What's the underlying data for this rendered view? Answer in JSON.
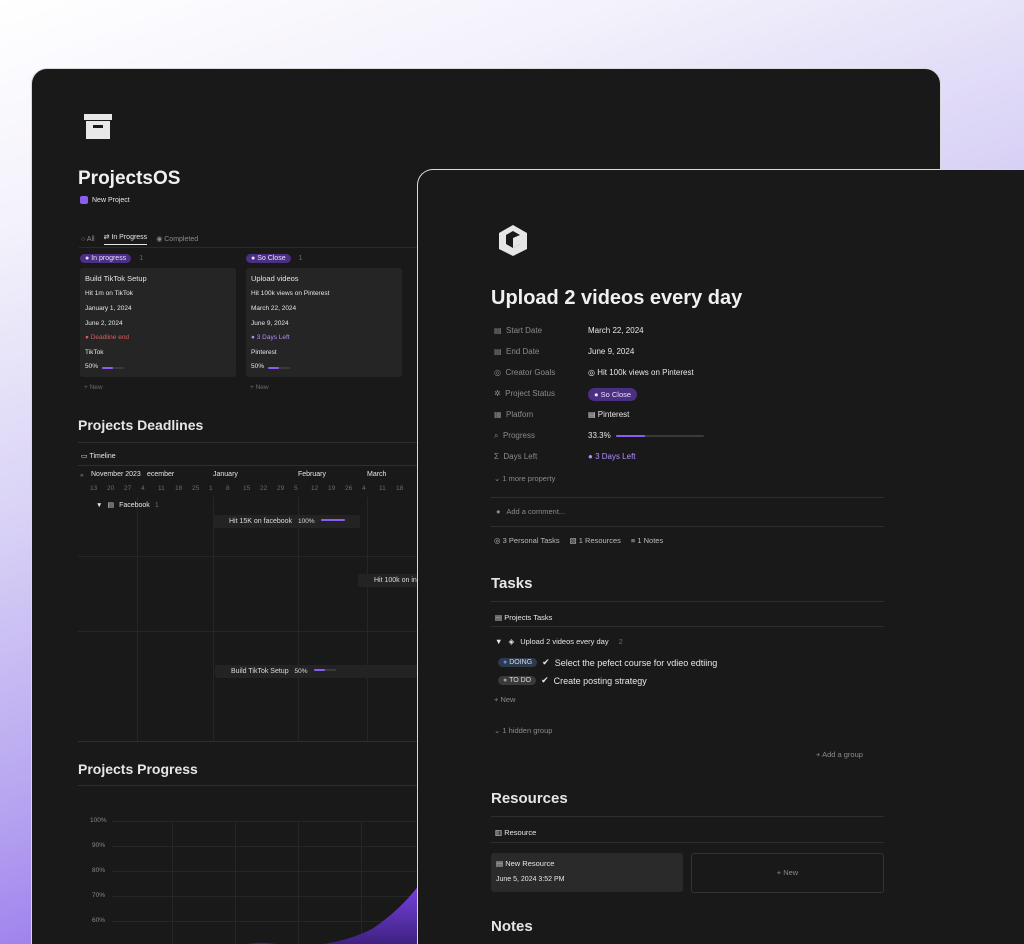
{
  "back": {
    "title": "ProjectsOS",
    "new_project": "New Project",
    "tabs": [
      "All",
      "In Progress",
      "Completed"
    ],
    "board": {
      "groups": [
        {
          "label": "In progress",
          "count": "1",
          "card": {
            "title": "Build TikTok Setup",
            "goal": "Hit 1m on TikTok",
            "start": "January 1, 2024",
            "end": "June 2, 2024",
            "status": "Deadline end",
            "platform": "TikTok",
            "progress_label": "50%",
            "progress": 0.5
          },
          "new": "New"
        },
        {
          "label": "So Close",
          "count": "1",
          "card": {
            "title": "Upload videos",
            "goal": "Hit 100k views on Pinterest",
            "start": "March 22, 2024",
            "end": "June 9, 2024",
            "status": "3  Days Left",
            "platform": "Pinterest",
            "progress_label": "50%",
            "progress": 0.5
          },
          "new": "New"
        }
      ]
    },
    "deadlines": {
      "heading": "Projects Deadlines",
      "view": "Timeline",
      "months": [
        "November 2023",
        "ecember",
        "January",
        "February",
        "March"
      ],
      "days": [
        "13",
        "20",
        "27",
        "4",
        "11",
        "18",
        "25",
        "1",
        "8",
        "15",
        "22",
        "29",
        "5",
        "12",
        "19",
        "26",
        "4",
        "11",
        "18"
      ],
      "group_label": "Facebook",
      "group_count": "1",
      "bars": [
        {
          "label": "Hit 15K on facebook",
          "pct": "100%",
          "progress": 1.0
        },
        {
          "label": "Hit 100k on in",
          "pct": "",
          "progress": 0
        },
        {
          "label": "Build TikTok Setup",
          "pct": "50%",
          "progress": 0.5
        }
      ]
    },
    "progress": {
      "heading": "Projects Progress",
      "y_ticks": [
        "100%",
        "90%",
        "80%",
        "70%",
        "60%"
      ]
    }
  },
  "front": {
    "title": "Upload 2 videos every day",
    "properties": [
      {
        "label": "Start Date",
        "value": "March 22, 2024",
        "icon": "calendar-icon"
      },
      {
        "label": "End Date",
        "value": "June 9, 2024",
        "icon": "calendar-icon"
      },
      {
        "label": "Creator Goals",
        "value": "Hit 100k views on Pinterest",
        "icon": "target-icon"
      },
      {
        "label": "Project Status",
        "value": "So Close",
        "icon": "status-icon"
      },
      {
        "label": "Platfom",
        "value": "Pinterest",
        "icon": "platform-icon"
      },
      {
        "label": "Progress",
        "value": "33.3%",
        "icon": "search-icon",
        "fraction": 0.333
      },
      {
        "label": "Days Left",
        "value": "3  Days Left",
        "icon": "sigma-icon"
      }
    ],
    "more_property": "1 more property",
    "comment_placeholder": "Add a comment...",
    "related": [
      "3 Personal Tasks",
      "1 Resources",
      "1 Notes"
    ],
    "tasks": {
      "heading": "Tasks",
      "view": "Projects Tasks",
      "group": "Upload 2 videos every day",
      "group_count": "2",
      "items": [
        {
          "status": "DOING",
          "text": "Select the pefect course for vdieo edtiing"
        },
        {
          "status": "TO DO",
          "text": "Create posting strategy"
        }
      ],
      "new": "New",
      "hidden_group": "1 hidden group",
      "add_group": "Add a group"
    },
    "resources": {
      "heading": "Resources",
      "view": "Resource",
      "card_title": "New Resource",
      "card_date": "June 5, 2024 3:52 PM",
      "new": "New"
    },
    "notes_heading": "Notes"
  },
  "colors": {
    "accent": "#8a5cf0",
    "deadline": "#e05a5a",
    "pill_purple": "#4b2f82"
  }
}
